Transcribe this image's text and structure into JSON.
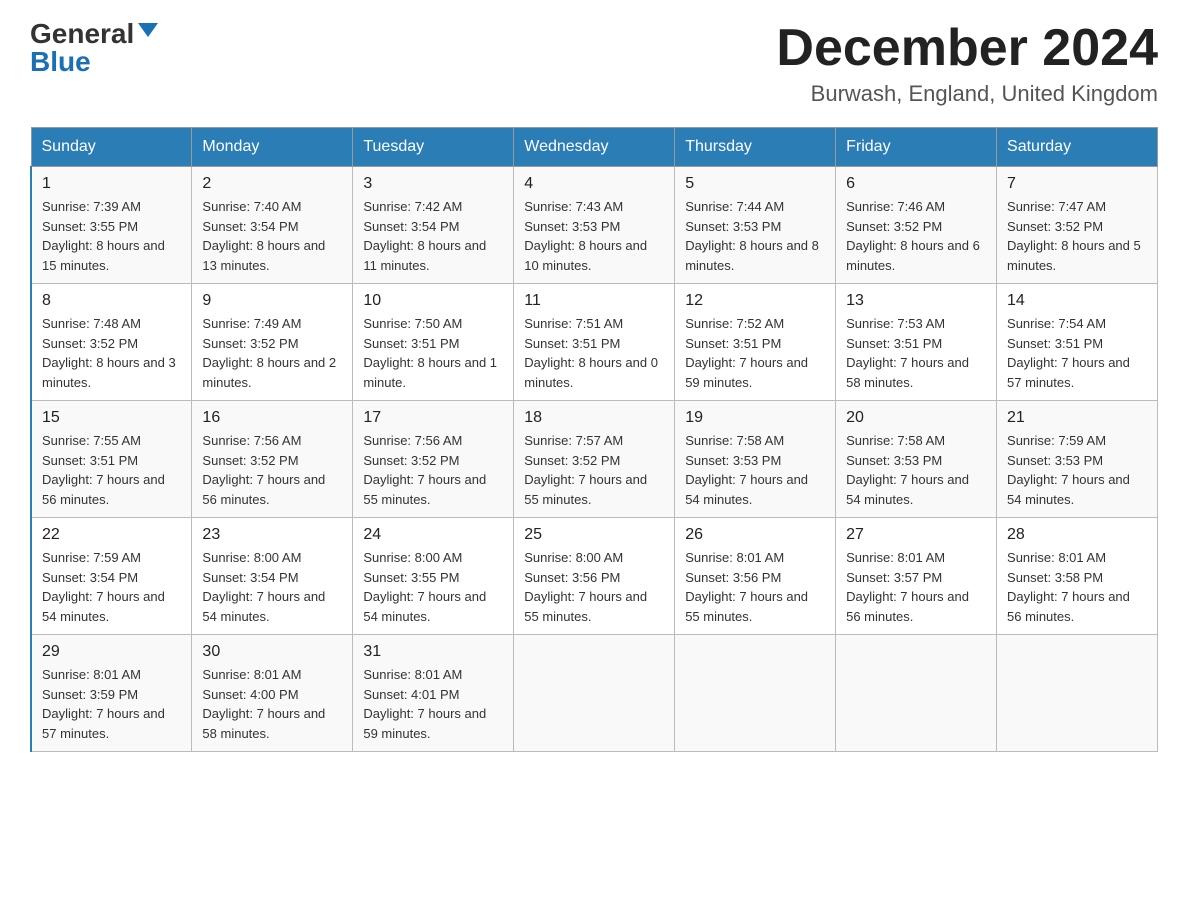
{
  "header": {
    "logo_general": "General",
    "logo_blue": "Blue",
    "month_title": "December 2024",
    "location": "Burwash, England, United Kingdom"
  },
  "columns": [
    "Sunday",
    "Monday",
    "Tuesday",
    "Wednesday",
    "Thursday",
    "Friday",
    "Saturday"
  ],
  "weeks": [
    [
      {
        "day": "1",
        "sunrise": "7:39 AM",
        "sunset": "3:55 PM",
        "daylight": "8 hours and 15 minutes."
      },
      {
        "day": "2",
        "sunrise": "7:40 AM",
        "sunset": "3:54 PM",
        "daylight": "8 hours and 13 minutes."
      },
      {
        "day": "3",
        "sunrise": "7:42 AM",
        "sunset": "3:54 PM",
        "daylight": "8 hours and 11 minutes."
      },
      {
        "day": "4",
        "sunrise": "7:43 AM",
        "sunset": "3:53 PM",
        "daylight": "8 hours and 10 minutes."
      },
      {
        "day": "5",
        "sunrise": "7:44 AM",
        "sunset": "3:53 PM",
        "daylight": "8 hours and 8 minutes."
      },
      {
        "day": "6",
        "sunrise": "7:46 AM",
        "sunset": "3:52 PM",
        "daylight": "8 hours and 6 minutes."
      },
      {
        "day": "7",
        "sunrise": "7:47 AM",
        "sunset": "3:52 PM",
        "daylight": "8 hours and 5 minutes."
      }
    ],
    [
      {
        "day": "8",
        "sunrise": "7:48 AM",
        "sunset": "3:52 PM",
        "daylight": "8 hours and 3 minutes."
      },
      {
        "day": "9",
        "sunrise": "7:49 AM",
        "sunset": "3:52 PM",
        "daylight": "8 hours and 2 minutes."
      },
      {
        "day": "10",
        "sunrise": "7:50 AM",
        "sunset": "3:51 PM",
        "daylight": "8 hours and 1 minute."
      },
      {
        "day": "11",
        "sunrise": "7:51 AM",
        "sunset": "3:51 PM",
        "daylight": "8 hours and 0 minutes."
      },
      {
        "day": "12",
        "sunrise": "7:52 AM",
        "sunset": "3:51 PM",
        "daylight": "7 hours and 59 minutes."
      },
      {
        "day": "13",
        "sunrise": "7:53 AM",
        "sunset": "3:51 PM",
        "daylight": "7 hours and 58 minutes."
      },
      {
        "day": "14",
        "sunrise": "7:54 AM",
        "sunset": "3:51 PM",
        "daylight": "7 hours and 57 minutes."
      }
    ],
    [
      {
        "day": "15",
        "sunrise": "7:55 AM",
        "sunset": "3:51 PM",
        "daylight": "7 hours and 56 minutes."
      },
      {
        "day": "16",
        "sunrise": "7:56 AM",
        "sunset": "3:52 PM",
        "daylight": "7 hours and 56 minutes."
      },
      {
        "day": "17",
        "sunrise": "7:56 AM",
        "sunset": "3:52 PM",
        "daylight": "7 hours and 55 minutes."
      },
      {
        "day": "18",
        "sunrise": "7:57 AM",
        "sunset": "3:52 PM",
        "daylight": "7 hours and 55 minutes."
      },
      {
        "day": "19",
        "sunrise": "7:58 AM",
        "sunset": "3:53 PM",
        "daylight": "7 hours and 54 minutes."
      },
      {
        "day": "20",
        "sunrise": "7:58 AM",
        "sunset": "3:53 PM",
        "daylight": "7 hours and 54 minutes."
      },
      {
        "day": "21",
        "sunrise": "7:59 AM",
        "sunset": "3:53 PM",
        "daylight": "7 hours and 54 minutes."
      }
    ],
    [
      {
        "day": "22",
        "sunrise": "7:59 AM",
        "sunset": "3:54 PM",
        "daylight": "7 hours and 54 minutes."
      },
      {
        "day": "23",
        "sunrise": "8:00 AM",
        "sunset": "3:54 PM",
        "daylight": "7 hours and 54 minutes."
      },
      {
        "day": "24",
        "sunrise": "8:00 AM",
        "sunset": "3:55 PM",
        "daylight": "7 hours and 54 minutes."
      },
      {
        "day": "25",
        "sunrise": "8:00 AM",
        "sunset": "3:56 PM",
        "daylight": "7 hours and 55 minutes."
      },
      {
        "day": "26",
        "sunrise": "8:01 AM",
        "sunset": "3:56 PM",
        "daylight": "7 hours and 55 minutes."
      },
      {
        "day": "27",
        "sunrise": "8:01 AM",
        "sunset": "3:57 PM",
        "daylight": "7 hours and 56 minutes."
      },
      {
        "day": "28",
        "sunrise": "8:01 AM",
        "sunset": "3:58 PM",
        "daylight": "7 hours and 56 minutes."
      }
    ],
    [
      {
        "day": "29",
        "sunrise": "8:01 AM",
        "sunset": "3:59 PM",
        "daylight": "7 hours and 57 minutes."
      },
      {
        "day": "30",
        "sunrise": "8:01 AM",
        "sunset": "4:00 PM",
        "daylight": "7 hours and 58 minutes."
      },
      {
        "day": "31",
        "sunrise": "8:01 AM",
        "sunset": "4:01 PM",
        "daylight": "7 hours and 59 minutes."
      },
      null,
      null,
      null,
      null
    ]
  ]
}
